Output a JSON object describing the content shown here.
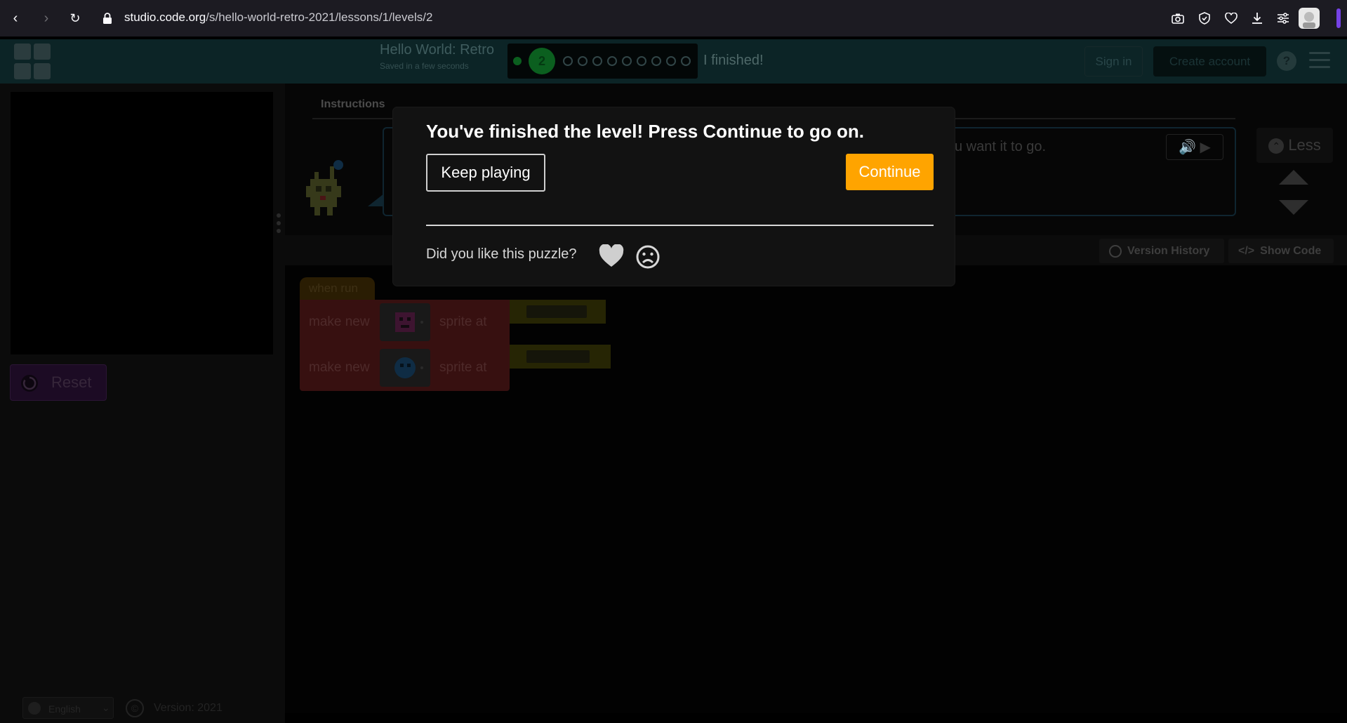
{
  "browser": {
    "url_domain": "studio.code.org",
    "url_path": "/s/hello-world-retro-2021/lessons/1/levels/2",
    "icons": [
      "back-icon",
      "forward-icon",
      "reload-icon",
      "lock-icon",
      "camera-icon",
      "shield-icon",
      "heart-icon",
      "download-icon",
      "menu-icon",
      "avatar"
    ]
  },
  "header": {
    "project_title": "Hello World: Retro",
    "saved_status": "Saved in a few seconds",
    "current_level": "2",
    "finished_label": "I finished!",
    "sign_in": "Sign in",
    "create_account": "Create account",
    "help": "?"
  },
  "left_pane": {
    "reset_label": "Reset",
    "language": "English",
    "version": "Version: 2021",
    "copyright": "©"
  },
  "instructions": {
    "tab_label": "Instructions",
    "partial_text": "u want it to go.",
    "less_label": "Less"
  },
  "workspace": {
    "version_history": "Version History",
    "show_code": "Show Code",
    "blocks": {
      "hat": "when run",
      "make_new": "make new",
      "sprite_at": "sprite at"
    }
  },
  "modal": {
    "title": "You've finished the level! Press Continue to go on.",
    "keep_playing": "Keep playing",
    "continue": "Continue",
    "feedback_prompt": "Did you like this puzzle?"
  },
  "colors": {
    "continue_bg": "#ffa400",
    "modal_bg": "#121212",
    "browser_bg": "#1c1b22",
    "browser_accent": "#7542e5"
  }
}
